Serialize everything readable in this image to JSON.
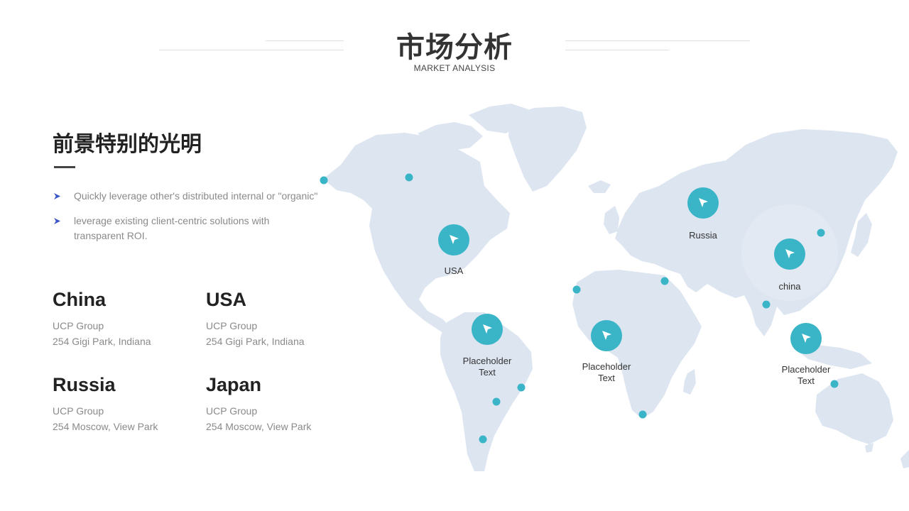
{
  "header": {
    "title": "市场分析",
    "subtitle": "MARKET ANALYSIS"
  },
  "intro": {
    "heading": "前景特别的光明",
    "bullets": [
      "Quickly leverage other's distributed internal or \"organic\"",
      "leverage existing client-centric solutions with transparent ROI."
    ]
  },
  "offices": [
    {
      "country": "China",
      "company": "UCP Group",
      "address": "254 Gigi Park, Indiana"
    },
    {
      "country": "USA",
      "company": "UCP Group",
      "address": "254 Gigi Park, Indiana"
    },
    {
      "country": "Russia",
      "company": "UCP Group",
      "address": "254 Moscow, View Park"
    },
    {
      "country": "Japan",
      "company": "UCP Group",
      "address": "254 Moscow, View Park"
    }
  ],
  "map": {
    "pins": [
      {
        "label_lines": [
          "USA"
        ]
      },
      {
        "label_lines": [
          "Placeholder",
          "Text"
        ]
      },
      {
        "label_lines": [
          "Placeholder",
          "Text"
        ]
      },
      {
        "label_lines": [
          "Russia"
        ]
      },
      {
        "label_lines": [
          "china"
        ]
      },
      {
        "label_lines": [
          "Placeholder",
          "Text"
        ]
      }
    ]
  },
  "colors": {
    "accent": "#3ab5c7",
    "map_land": "#dde5f1",
    "bullet_icon": "#3a55c8",
    "heading": "#222222",
    "muted_text": "#8a8a8a"
  },
  "icons": {
    "pin": "cursor-arrow-icon",
    "bullet": "arrow-bullet-icon"
  }
}
